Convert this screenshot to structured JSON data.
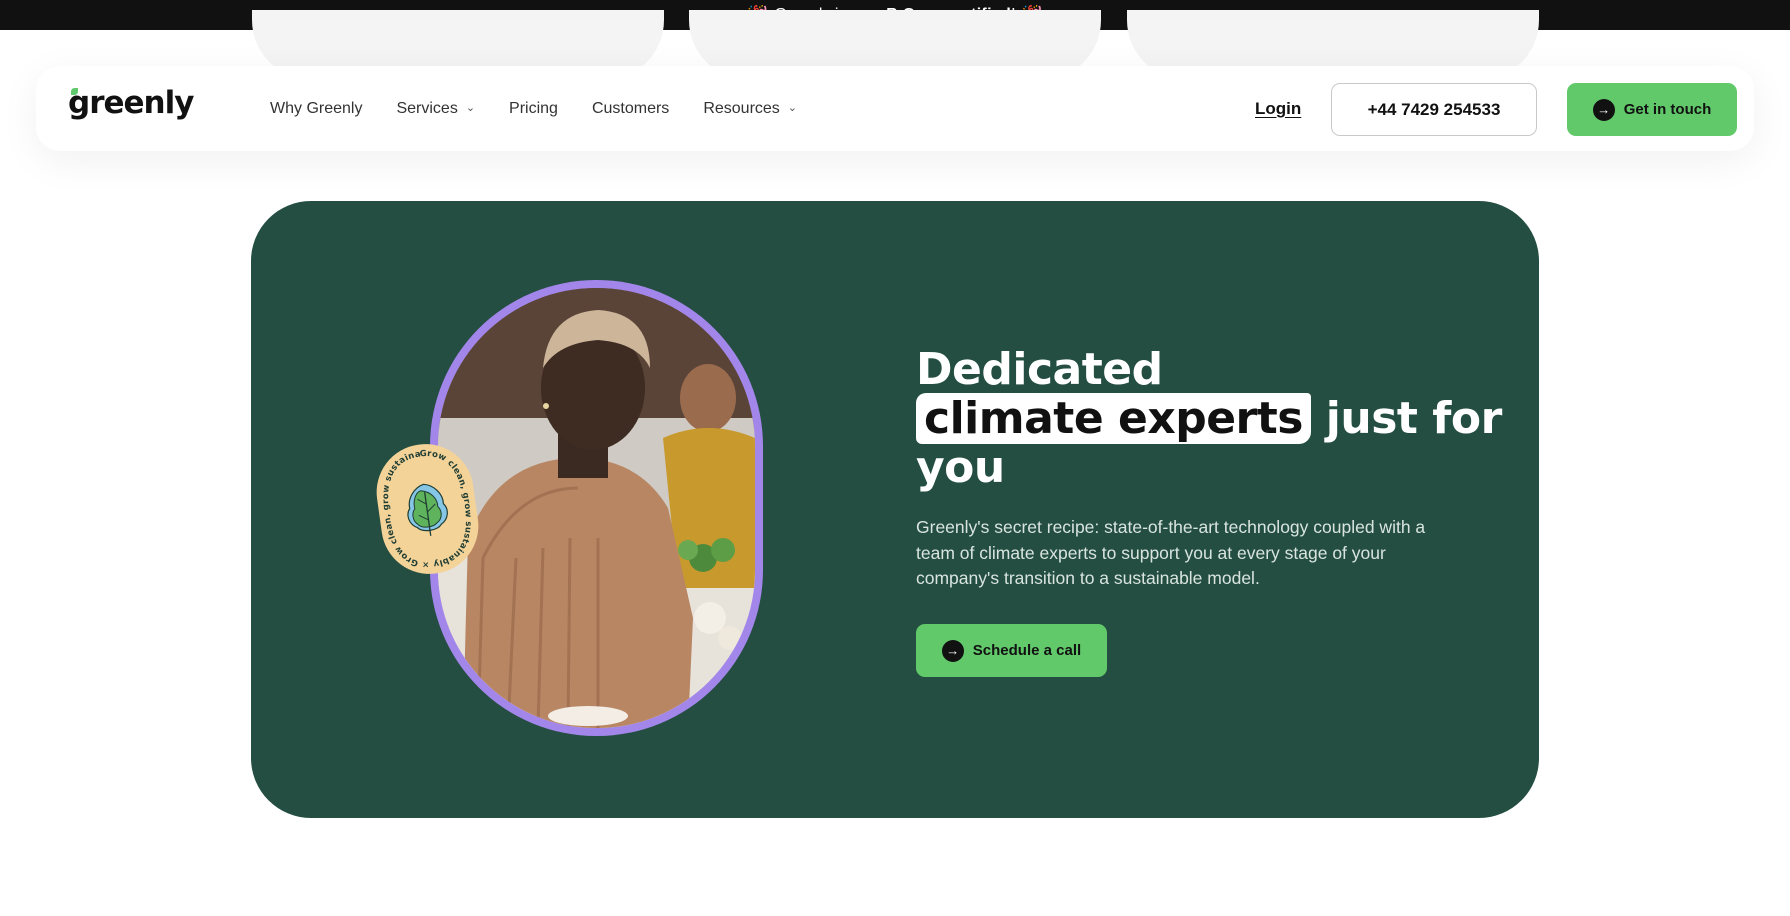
{
  "announcement": {
    "emoji_left": "🎉",
    "prefix": "Greenly is now",
    "highlight": "B Corp certified",
    "suffix": "!",
    "emoji_right": "🎉"
  },
  "header": {
    "logo_text_part1": "gr",
    "logo_text_part2": "eenly",
    "nav": [
      {
        "label": "Why Greenly",
        "has_dropdown": false
      },
      {
        "label": "Services",
        "has_dropdown": true
      },
      {
        "label": "Pricing",
        "has_dropdown": false
      },
      {
        "label": "Customers",
        "has_dropdown": false
      },
      {
        "label": "Resources",
        "has_dropdown": true
      }
    ],
    "login_label": "Login",
    "phone_label": "+44 7429 254533",
    "cta_label": "Get in touch"
  },
  "hero": {
    "headline_line1": "Dedicated",
    "headline_highlight": "climate experts",
    "headline_after_highlight": " just for",
    "headline_line3": "you",
    "description": "Greenly's secret recipe: state-of-the-art technology coupled with a team of climate experts to support you at every stage of your company's transition to a sustainable model.",
    "button_label": "Schedule a call",
    "badge_text": "Grow clean, grow sustainably × Grow clean, grow sustainably ×"
  },
  "colors": {
    "brand_green": "#62c96b",
    "hero_bg": "#234e41",
    "ring_purple": "#a386ea",
    "badge_bg": "#f4d399",
    "announcement_bg": "#111111"
  },
  "icons": {
    "dropdown": "chevron-down-icon",
    "cta_arrow": "arrow-right-circle-icon",
    "badge_leaf": "leaf-icon",
    "announcement": "party-popper-icon"
  }
}
